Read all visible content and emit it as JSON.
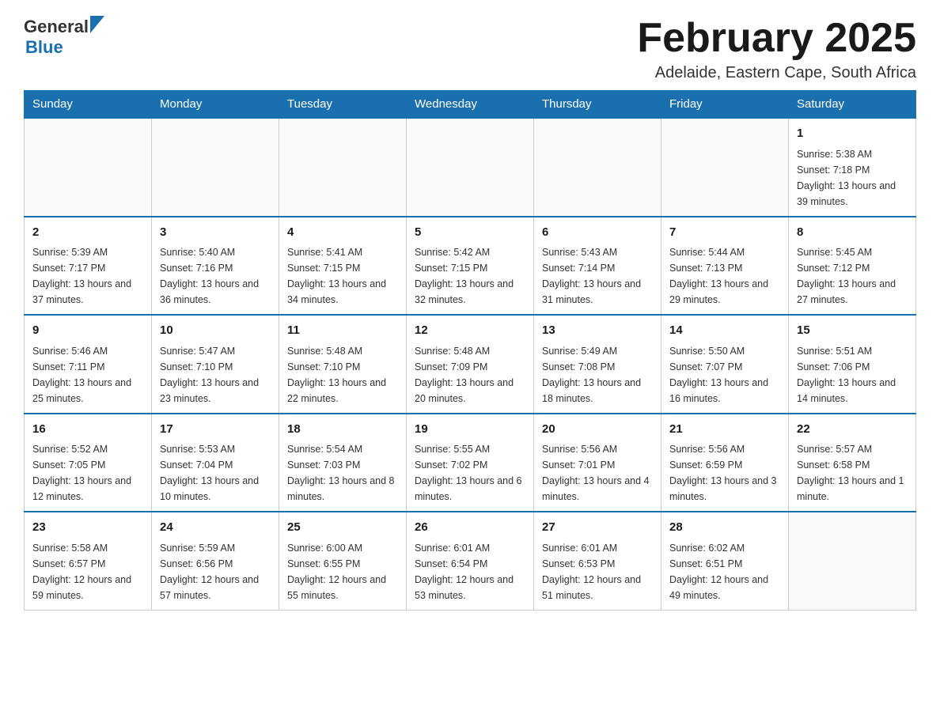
{
  "header": {
    "logo_general": "General",
    "logo_blue": "Blue",
    "month_title": "February 2025",
    "subtitle": "Adelaide, Eastern Cape, South Africa"
  },
  "days_of_week": [
    "Sunday",
    "Monday",
    "Tuesday",
    "Wednesday",
    "Thursday",
    "Friday",
    "Saturday"
  ],
  "weeks": [
    [
      {
        "day": "",
        "info": ""
      },
      {
        "day": "",
        "info": ""
      },
      {
        "day": "",
        "info": ""
      },
      {
        "day": "",
        "info": ""
      },
      {
        "day": "",
        "info": ""
      },
      {
        "day": "",
        "info": ""
      },
      {
        "day": "1",
        "info": "Sunrise: 5:38 AM\nSunset: 7:18 PM\nDaylight: 13 hours and 39 minutes."
      }
    ],
    [
      {
        "day": "2",
        "info": "Sunrise: 5:39 AM\nSunset: 7:17 PM\nDaylight: 13 hours and 37 minutes."
      },
      {
        "day": "3",
        "info": "Sunrise: 5:40 AM\nSunset: 7:16 PM\nDaylight: 13 hours and 36 minutes."
      },
      {
        "day": "4",
        "info": "Sunrise: 5:41 AM\nSunset: 7:15 PM\nDaylight: 13 hours and 34 minutes."
      },
      {
        "day": "5",
        "info": "Sunrise: 5:42 AM\nSunset: 7:15 PM\nDaylight: 13 hours and 32 minutes."
      },
      {
        "day": "6",
        "info": "Sunrise: 5:43 AM\nSunset: 7:14 PM\nDaylight: 13 hours and 31 minutes."
      },
      {
        "day": "7",
        "info": "Sunrise: 5:44 AM\nSunset: 7:13 PM\nDaylight: 13 hours and 29 minutes."
      },
      {
        "day": "8",
        "info": "Sunrise: 5:45 AM\nSunset: 7:12 PM\nDaylight: 13 hours and 27 minutes."
      }
    ],
    [
      {
        "day": "9",
        "info": "Sunrise: 5:46 AM\nSunset: 7:11 PM\nDaylight: 13 hours and 25 minutes."
      },
      {
        "day": "10",
        "info": "Sunrise: 5:47 AM\nSunset: 7:10 PM\nDaylight: 13 hours and 23 minutes."
      },
      {
        "day": "11",
        "info": "Sunrise: 5:48 AM\nSunset: 7:10 PM\nDaylight: 13 hours and 22 minutes."
      },
      {
        "day": "12",
        "info": "Sunrise: 5:48 AM\nSunset: 7:09 PM\nDaylight: 13 hours and 20 minutes."
      },
      {
        "day": "13",
        "info": "Sunrise: 5:49 AM\nSunset: 7:08 PM\nDaylight: 13 hours and 18 minutes."
      },
      {
        "day": "14",
        "info": "Sunrise: 5:50 AM\nSunset: 7:07 PM\nDaylight: 13 hours and 16 minutes."
      },
      {
        "day": "15",
        "info": "Sunrise: 5:51 AM\nSunset: 7:06 PM\nDaylight: 13 hours and 14 minutes."
      }
    ],
    [
      {
        "day": "16",
        "info": "Sunrise: 5:52 AM\nSunset: 7:05 PM\nDaylight: 13 hours and 12 minutes."
      },
      {
        "day": "17",
        "info": "Sunrise: 5:53 AM\nSunset: 7:04 PM\nDaylight: 13 hours and 10 minutes."
      },
      {
        "day": "18",
        "info": "Sunrise: 5:54 AM\nSunset: 7:03 PM\nDaylight: 13 hours and 8 minutes."
      },
      {
        "day": "19",
        "info": "Sunrise: 5:55 AM\nSunset: 7:02 PM\nDaylight: 13 hours and 6 minutes."
      },
      {
        "day": "20",
        "info": "Sunrise: 5:56 AM\nSunset: 7:01 PM\nDaylight: 13 hours and 4 minutes."
      },
      {
        "day": "21",
        "info": "Sunrise: 5:56 AM\nSunset: 6:59 PM\nDaylight: 13 hours and 3 minutes."
      },
      {
        "day": "22",
        "info": "Sunrise: 5:57 AM\nSunset: 6:58 PM\nDaylight: 13 hours and 1 minute."
      }
    ],
    [
      {
        "day": "23",
        "info": "Sunrise: 5:58 AM\nSunset: 6:57 PM\nDaylight: 12 hours and 59 minutes."
      },
      {
        "day": "24",
        "info": "Sunrise: 5:59 AM\nSunset: 6:56 PM\nDaylight: 12 hours and 57 minutes."
      },
      {
        "day": "25",
        "info": "Sunrise: 6:00 AM\nSunset: 6:55 PM\nDaylight: 12 hours and 55 minutes."
      },
      {
        "day": "26",
        "info": "Sunrise: 6:01 AM\nSunset: 6:54 PM\nDaylight: 12 hours and 53 minutes."
      },
      {
        "day": "27",
        "info": "Sunrise: 6:01 AM\nSunset: 6:53 PM\nDaylight: 12 hours and 51 minutes."
      },
      {
        "day": "28",
        "info": "Sunrise: 6:02 AM\nSunset: 6:51 PM\nDaylight: 12 hours and 49 minutes."
      },
      {
        "day": "",
        "info": ""
      }
    ]
  ]
}
